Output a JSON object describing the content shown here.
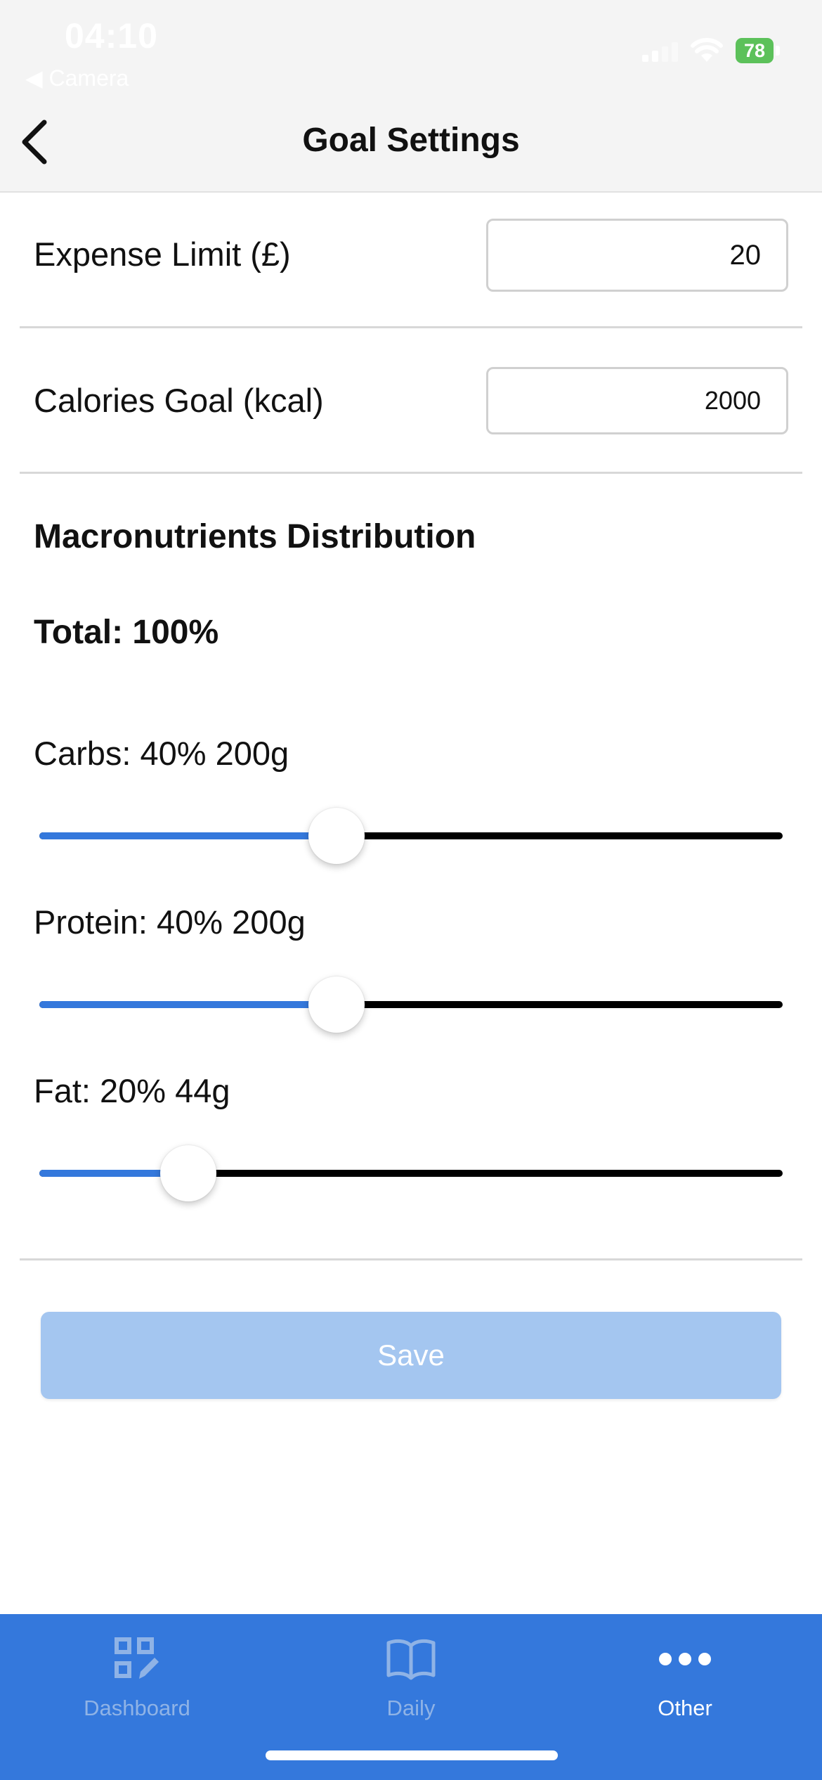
{
  "status_bar": {
    "time": "04:10",
    "back_app": "◀ Camera",
    "battery": "78"
  },
  "header": {
    "title": "Goal Settings",
    "back_icon": "chevron-left-icon"
  },
  "form": {
    "expense": {
      "label": "Expense Limit (£)",
      "value": "20"
    },
    "calories": {
      "label": "Calories Goal (kcal)",
      "value": "2000"
    }
  },
  "macros": {
    "title": "Macronutrients Distribution",
    "total": "Total: 100%",
    "sliders": [
      {
        "label": "Carbs: 40% 200g",
        "value": 0.4
      },
      {
        "label": "Protein: 40% 200g",
        "value": 0.4
      },
      {
        "label": "Fat: 20% 44g",
        "value": 0.2
      }
    ]
  },
  "save_label": "Save",
  "tabs": [
    {
      "label": "Dashboard",
      "icon": "dashboard-icon",
      "active": false
    },
    {
      "label": "Daily",
      "icon": "book-icon",
      "active": false
    },
    {
      "label": "Other",
      "icon": "more-icon",
      "active": true
    }
  ],
  "colors": {
    "accent": "#3478dc",
    "save_disabled": "#a4c6f0",
    "battery": "#5cc15a"
  }
}
